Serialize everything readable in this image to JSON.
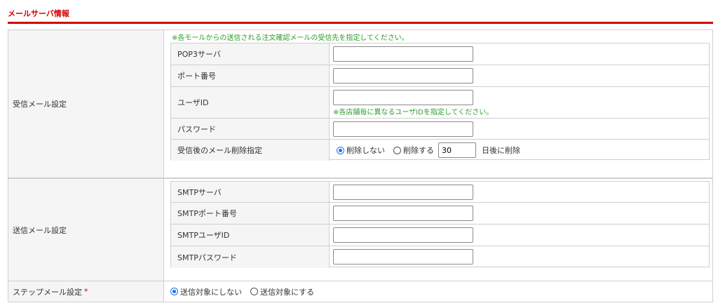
{
  "section_title": "メールサーバ情報",
  "receive": {
    "label": "受信メール設定",
    "notice": "※各モールからの送信される注文確認メールの受信先を指定してください。",
    "pop3_label": "POP3サーバ",
    "port_label": "ポート番号",
    "userid_label": "ユーザID",
    "userid_notice": "※各店舗毎に異なるユーザIDを指定してください。",
    "password_label": "パスワード",
    "delete_label": "受信後のメール削除指定",
    "delete_no": "削除しない",
    "delete_yes": "削除する",
    "delete_days": "30",
    "delete_suffix": "日後に削除"
  },
  "send": {
    "label": "送信メール設定",
    "smtp_label": "SMTPサーバ",
    "smtp_port_label": "SMTPポート番号",
    "smtp_user_label": "SMTPユーザID",
    "smtp_password_label": "SMTPパスワード"
  },
  "step": {
    "label": "ステップメール設定",
    "required_mark": "*",
    "option_off": "送信対象にしない",
    "option_on": "送信対象にする"
  },
  "colors": {
    "accent": "#d20000",
    "notice": "#2e9d2e",
    "radio": "#1a73e8"
  }
}
